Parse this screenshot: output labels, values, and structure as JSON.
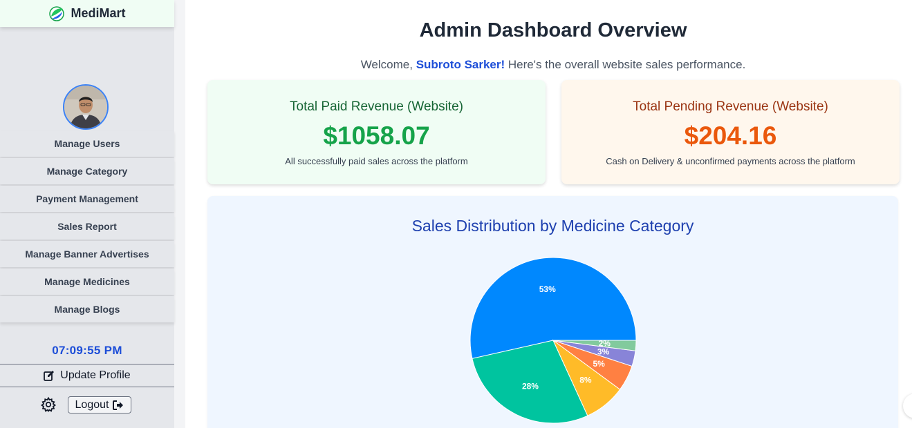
{
  "brand": {
    "name": "MediMart"
  },
  "sidebar": {
    "items": [
      {
        "label": "Manage Users"
      },
      {
        "label": "Manage Category"
      },
      {
        "label": "Payment Management"
      },
      {
        "label": "Sales Report"
      },
      {
        "label": "Manage Banner Advertises"
      },
      {
        "label": "Manage Medicines"
      },
      {
        "label": "Manage Blogs"
      }
    ],
    "clock": "07:09:55 PM",
    "update_profile": "Update Profile",
    "logout": "Logout"
  },
  "header": {
    "title": "Admin Dashboard Overview",
    "welcome_prefix": "Welcome, ",
    "user_name": "Subroto Sarker!",
    "welcome_suffix": " Here's the overall website sales performance."
  },
  "cards": {
    "paid": {
      "title": "Total Paid Revenue (Website)",
      "amount": "$1058.07",
      "desc": "All successfully paid sales across the platform"
    },
    "pending": {
      "title": "Total Pending Revenue (Website)",
      "amount": "$204.16",
      "desc": "Cash on Delivery & unconfirmed payments across the platform"
    }
  },
  "colors": {
    "accent_blue": "#1d4ed8",
    "paid_green": "#16a34a",
    "pending_orange": "#ea580c"
  },
  "chart_data": {
    "type": "pie",
    "title": "Sales Distribution by Medicine Category",
    "values": [
      53,
      28,
      8,
      5,
      3,
      2
    ],
    "labels": [
      "53%",
      "28%",
      "8%",
      "5%",
      "3%",
      "2%"
    ],
    "colors": [
      "#0088fe",
      "#00c49f",
      "#ffbb28",
      "#ff8042",
      "#8884d8",
      "#82ca9d"
    ]
  }
}
